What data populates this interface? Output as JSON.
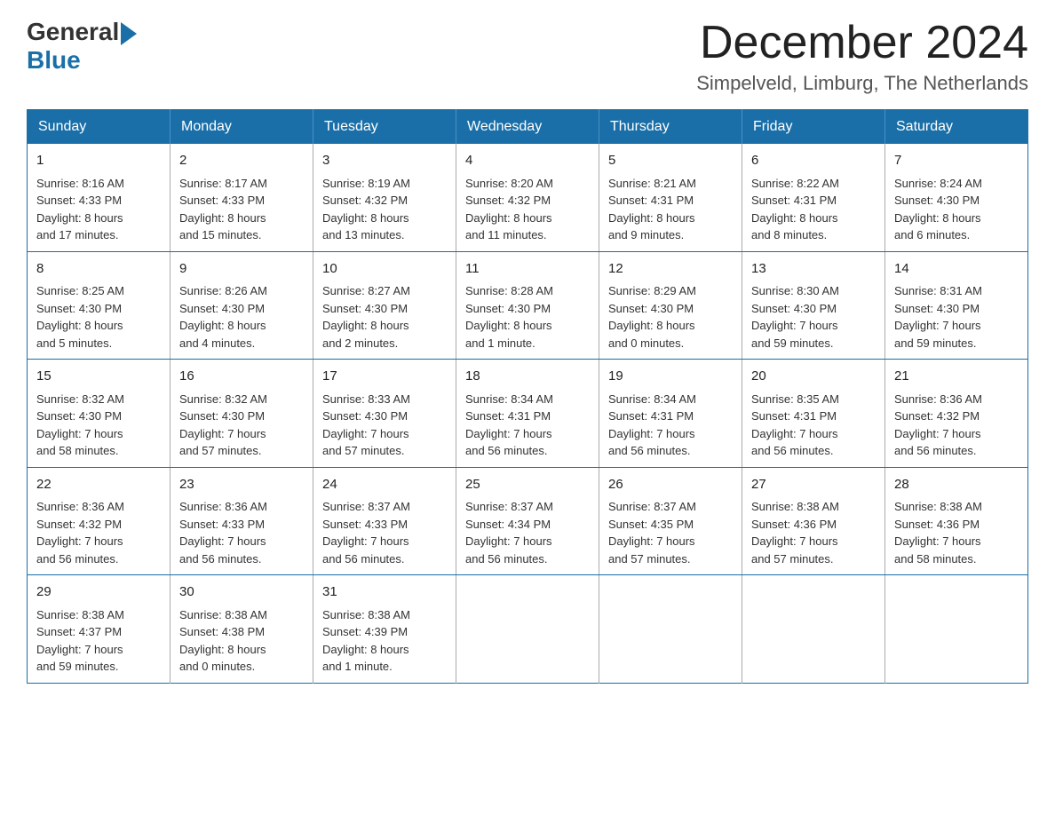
{
  "header": {
    "logo_general": "General",
    "logo_blue": "Blue",
    "month_title": "December 2024",
    "location": "Simpelveld, Limburg, The Netherlands"
  },
  "days_of_week": [
    "Sunday",
    "Monday",
    "Tuesday",
    "Wednesday",
    "Thursday",
    "Friday",
    "Saturday"
  ],
  "weeks": [
    [
      {
        "day": "1",
        "sunrise": "8:16 AM",
        "sunset": "4:33 PM",
        "daylight": "8 hours and 17 minutes."
      },
      {
        "day": "2",
        "sunrise": "8:17 AM",
        "sunset": "4:33 PM",
        "daylight": "8 hours and 15 minutes."
      },
      {
        "day": "3",
        "sunrise": "8:19 AM",
        "sunset": "4:32 PM",
        "daylight": "8 hours and 13 minutes."
      },
      {
        "day": "4",
        "sunrise": "8:20 AM",
        "sunset": "4:32 PM",
        "daylight": "8 hours and 11 minutes."
      },
      {
        "day": "5",
        "sunrise": "8:21 AM",
        "sunset": "4:31 PM",
        "daylight": "8 hours and 9 minutes."
      },
      {
        "day": "6",
        "sunrise": "8:22 AM",
        "sunset": "4:31 PM",
        "daylight": "8 hours and 8 minutes."
      },
      {
        "day": "7",
        "sunrise": "8:24 AM",
        "sunset": "4:30 PM",
        "daylight": "8 hours and 6 minutes."
      }
    ],
    [
      {
        "day": "8",
        "sunrise": "8:25 AM",
        "sunset": "4:30 PM",
        "daylight": "8 hours and 5 minutes."
      },
      {
        "day": "9",
        "sunrise": "8:26 AM",
        "sunset": "4:30 PM",
        "daylight": "8 hours and 4 minutes."
      },
      {
        "day": "10",
        "sunrise": "8:27 AM",
        "sunset": "4:30 PM",
        "daylight": "8 hours and 2 minutes."
      },
      {
        "day": "11",
        "sunrise": "8:28 AM",
        "sunset": "4:30 PM",
        "daylight": "8 hours and 1 minute."
      },
      {
        "day": "12",
        "sunrise": "8:29 AM",
        "sunset": "4:30 PM",
        "daylight": "8 hours and 0 minutes."
      },
      {
        "day": "13",
        "sunrise": "8:30 AM",
        "sunset": "4:30 PM",
        "daylight": "7 hours and 59 minutes."
      },
      {
        "day": "14",
        "sunrise": "8:31 AM",
        "sunset": "4:30 PM",
        "daylight": "7 hours and 59 minutes."
      }
    ],
    [
      {
        "day": "15",
        "sunrise": "8:32 AM",
        "sunset": "4:30 PM",
        "daylight": "7 hours and 58 minutes."
      },
      {
        "day": "16",
        "sunrise": "8:32 AM",
        "sunset": "4:30 PM",
        "daylight": "7 hours and 57 minutes."
      },
      {
        "day": "17",
        "sunrise": "8:33 AM",
        "sunset": "4:30 PM",
        "daylight": "7 hours and 57 minutes."
      },
      {
        "day": "18",
        "sunrise": "8:34 AM",
        "sunset": "4:31 PM",
        "daylight": "7 hours and 56 minutes."
      },
      {
        "day": "19",
        "sunrise": "8:34 AM",
        "sunset": "4:31 PM",
        "daylight": "7 hours and 56 minutes."
      },
      {
        "day": "20",
        "sunrise": "8:35 AM",
        "sunset": "4:31 PM",
        "daylight": "7 hours and 56 minutes."
      },
      {
        "day": "21",
        "sunrise": "8:36 AM",
        "sunset": "4:32 PM",
        "daylight": "7 hours and 56 minutes."
      }
    ],
    [
      {
        "day": "22",
        "sunrise": "8:36 AM",
        "sunset": "4:32 PM",
        "daylight": "7 hours and 56 minutes."
      },
      {
        "day": "23",
        "sunrise": "8:36 AM",
        "sunset": "4:33 PM",
        "daylight": "7 hours and 56 minutes."
      },
      {
        "day": "24",
        "sunrise": "8:37 AM",
        "sunset": "4:33 PM",
        "daylight": "7 hours and 56 minutes."
      },
      {
        "day": "25",
        "sunrise": "8:37 AM",
        "sunset": "4:34 PM",
        "daylight": "7 hours and 56 minutes."
      },
      {
        "day": "26",
        "sunrise": "8:37 AM",
        "sunset": "4:35 PM",
        "daylight": "7 hours and 57 minutes."
      },
      {
        "day": "27",
        "sunrise": "8:38 AM",
        "sunset": "4:36 PM",
        "daylight": "7 hours and 57 minutes."
      },
      {
        "day": "28",
        "sunrise": "8:38 AM",
        "sunset": "4:36 PM",
        "daylight": "7 hours and 58 minutes."
      }
    ],
    [
      {
        "day": "29",
        "sunrise": "8:38 AM",
        "sunset": "4:37 PM",
        "daylight": "7 hours and 59 minutes."
      },
      {
        "day": "30",
        "sunrise": "8:38 AM",
        "sunset": "4:38 PM",
        "daylight": "8 hours and 0 minutes."
      },
      {
        "day": "31",
        "sunrise": "8:38 AM",
        "sunset": "4:39 PM",
        "daylight": "8 hours and 1 minute."
      },
      null,
      null,
      null,
      null
    ]
  ],
  "labels": {
    "sunrise": "Sunrise:",
    "sunset": "Sunset:",
    "daylight": "Daylight:"
  }
}
